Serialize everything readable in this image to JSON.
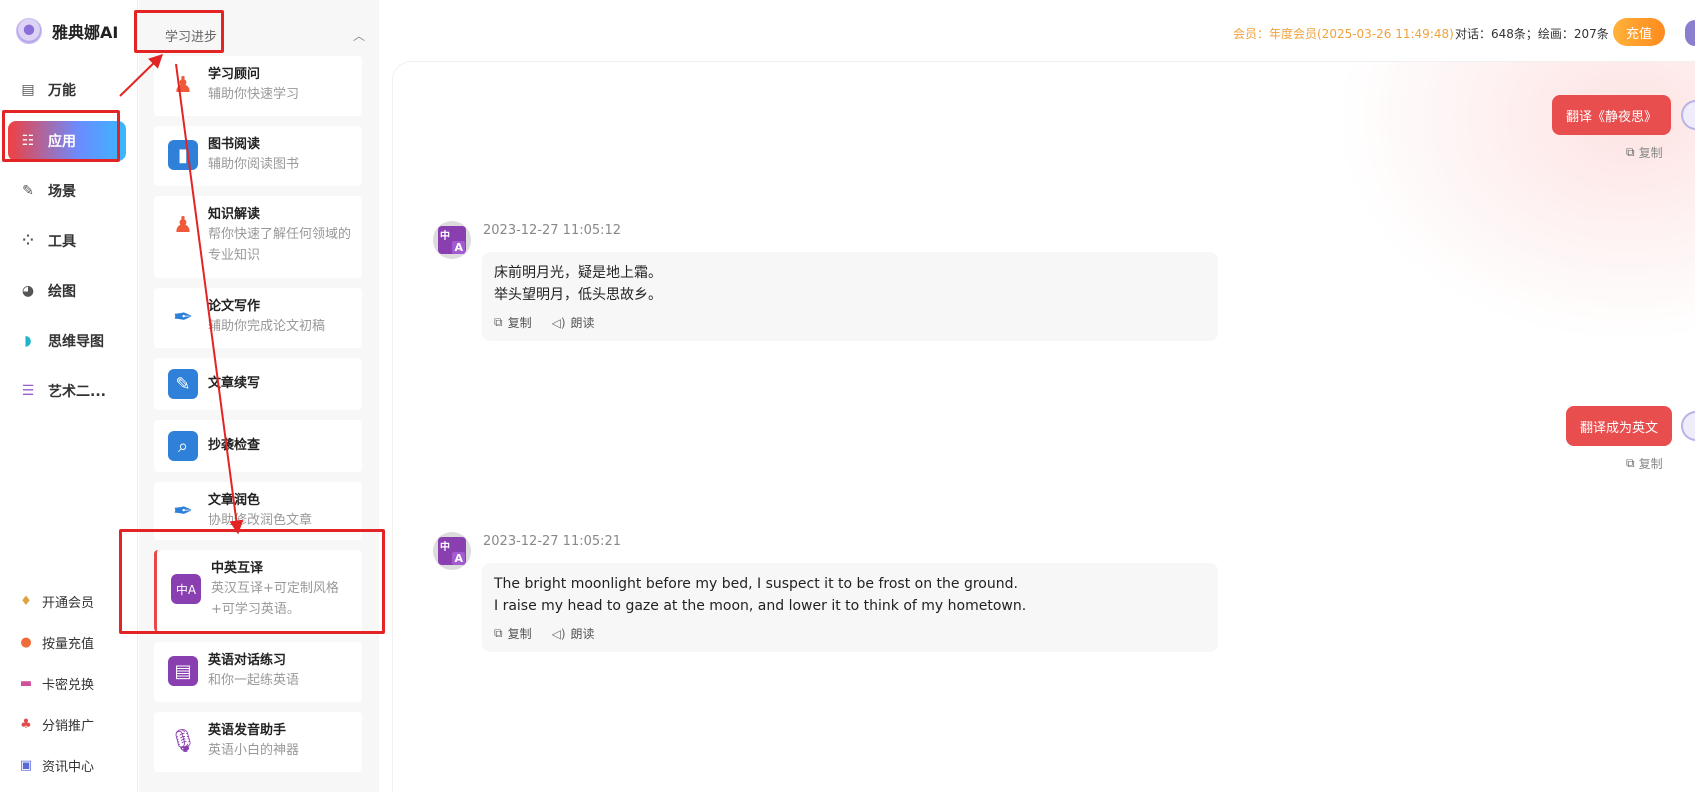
{
  "brand": {
    "name": "雅典娜AI"
  },
  "nav": {
    "items": [
      {
        "label": "万能",
        "icon": "chat-icon"
      },
      {
        "label": "应用",
        "icon": "apps-icon"
      },
      {
        "label": "场景",
        "icon": "pen-icon"
      },
      {
        "label": "工具",
        "icon": "tools-icon"
      },
      {
        "label": "绘图",
        "icon": "palette-icon"
      },
      {
        "label": "思维导图",
        "icon": "mindmap-icon"
      },
      {
        "label": "艺术二...",
        "icon": "doc-icon"
      }
    ],
    "active_index": 1,
    "bottom": [
      {
        "label": "开通会员",
        "icon": "vip-icon"
      },
      {
        "label": "按量充值",
        "icon": "coin-icon"
      },
      {
        "label": "卡密兑换",
        "icon": "card-icon"
      },
      {
        "label": "分销推广",
        "icon": "share-icon"
      },
      {
        "label": "资讯中心",
        "icon": "news-icon"
      }
    ]
  },
  "category": {
    "title": "学习进步",
    "apps": [
      {
        "title": "学习顾问",
        "desc": "辅助你快速学习",
        "icon": "teacher-icon",
        "color": "#f05a3c"
      },
      {
        "title": "图书阅读",
        "desc": "辅助你阅读图书",
        "icon": "book-icon",
        "color": "#2f80d8"
      },
      {
        "title": "知识解读",
        "desc": "帮你快速了解任何领域的专业知识",
        "icon": "teacher-icon",
        "color": "#f05a3c"
      },
      {
        "title": "论文写作",
        "desc": "辅助你完成论文初稿",
        "icon": "feather-icon",
        "color": "#2f80d8"
      },
      {
        "title": "文章续写",
        "desc": "",
        "icon": "edit-doc-icon",
        "color": "#2f80d8"
      },
      {
        "title": "抄袭检查",
        "desc": "",
        "icon": "search-doc-icon",
        "color": "#2f80d8"
      },
      {
        "title": "文章润色",
        "desc": "协助修改润色文章",
        "icon": "feather-icon",
        "color": "#2f80d8"
      },
      {
        "title": "中英互译",
        "desc": "英汉互译+可定制风格+可学习英语。",
        "icon": "translate-icon",
        "color": "#8a3fb0"
      },
      {
        "title": "英语对话练习",
        "desc": "和你一起练英语",
        "icon": "dialog-icon",
        "color": "#8a3fb0"
      },
      {
        "title": "英语发音助手",
        "desc": "英语小白的神器",
        "icon": "mic-icon",
        "color": "#8a3fb0"
      }
    ]
  },
  "header": {
    "member": "会员：年度会员(2025-03-26 11:49:48)",
    "quota": "对话：648条；绘画：207条",
    "recharge": "充值"
  },
  "chat": {
    "messages": [
      {
        "role": "user",
        "text": "翻译《静夜思》",
        "copy": "复制"
      },
      {
        "role": "bot",
        "time": "2023-12-27 11:05:12",
        "lines": [
          "床前明月光，疑是地上霜。",
          "举头望明月，低头思故乡。"
        ],
        "copy": "复制",
        "read": "朗读"
      },
      {
        "role": "user",
        "text": "翻译成为英文",
        "copy": "复制"
      },
      {
        "role": "bot",
        "time": "2023-12-27 11:05:21",
        "lines": [
          "The bright moonlight before my bed, I suspect it to be frost on the ground.",
          "I raise my head to gaze at the moon, and lower it to think of my hometown."
        ],
        "copy": "复制",
        "read": "朗读"
      }
    ]
  },
  "annotation_color": "#e32424"
}
